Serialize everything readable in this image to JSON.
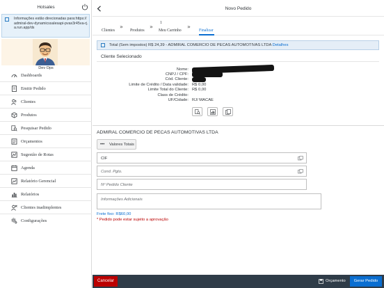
{
  "sidebar": {
    "title": "Hotsales",
    "info": "Informações estão direcionadas para:https://admiral-dev-dynamicssalesapi-pvax3r45va-rj.a.run.app/ds",
    "user_name": "Dev Ops",
    "items": [
      {
        "label": "Dashboards",
        "icon": "dashboard-icon"
      },
      {
        "label": "Emitir Pedido",
        "icon": "document-icon"
      },
      {
        "label": "Clientes",
        "icon": "customers-icon"
      },
      {
        "label": "Produtos",
        "icon": "product-icon"
      },
      {
        "label": "Pesquisar Pedido",
        "icon": "search-order-icon"
      },
      {
        "label": "Orçamentos",
        "icon": "quotation-icon"
      },
      {
        "label": "Sugestão de Rotas",
        "icon": "route-icon"
      },
      {
        "label": "Agenda",
        "icon": "calendar-icon"
      },
      {
        "label": "Relatório Gerencial",
        "icon": "report-icon"
      },
      {
        "label": "Relatórios",
        "icon": "bar-chart-icon"
      },
      {
        "label": "Clientes inadimplentes",
        "icon": "delinquent-icon"
      },
      {
        "label": "Configurações",
        "icon": "settings-icon"
      }
    ]
  },
  "header": {
    "title": "Novo Pedido"
  },
  "steps": {
    "clientes": "Clientes",
    "produtos": "Produtos",
    "carrinho_count": "1",
    "carrinho": "Meu Carrinho",
    "finalizar": "Finalizar"
  },
  "banner": {
    "text": "Total (Sem impostos) R$ 24,39 - ADMIRAL COMERCIO DE PECAS AUTOMOTIVAS LTDA",
    "link": "Detalhes"
  },
  "client": {
    "title": "Cliente Selecionado",
    "labels": {
      "nome": "Nome:",
      "cnpj": "CNPJ / CPF:",
      "cod": "Cód. Cliente:",
      "limite_credito": "Limite de Crédito / Data validade:",
      "limite_total": "Limite Total do Cliente:",
      "classe": "Class de Crédito:",
      "uf": "UF/Cidade:"
    },
    "values": {
      "limite_credito": "R$ 0,00",
      "limite_total": "R$ 0,00",
      "uf": "RJ/ MACAE"
    }
  },
  "order": {
    "company": "ADMIRAL COMERCIO DE PECAS AUTOMOTIVAS LTDA",
    "totals_button": "Valores Totais",
    "totals_dots": "•••",
    "freight_type": "CIF",
    "payment_placeholder": "Cond. Pgto.",
    "client_order_placeholder": "Nº Pedido Cliente",
    "info_placeholder": "Informações Adicionais",
    "freight_text": "Frete fixo: R$60,00",
    "warning_text": "* Pedido pode estar sujeito a aprovação"
  },
  "footer": {
    "cancel": "Cancelar",
    "quote": "Orçamento",
    "generate": "Gerar Pedido"
  },
  "colors": {
    "accent": "#0a6ed1",
    "danger": "#bb0000",
    "footer_bg": "#2f3c48"
  }
}
